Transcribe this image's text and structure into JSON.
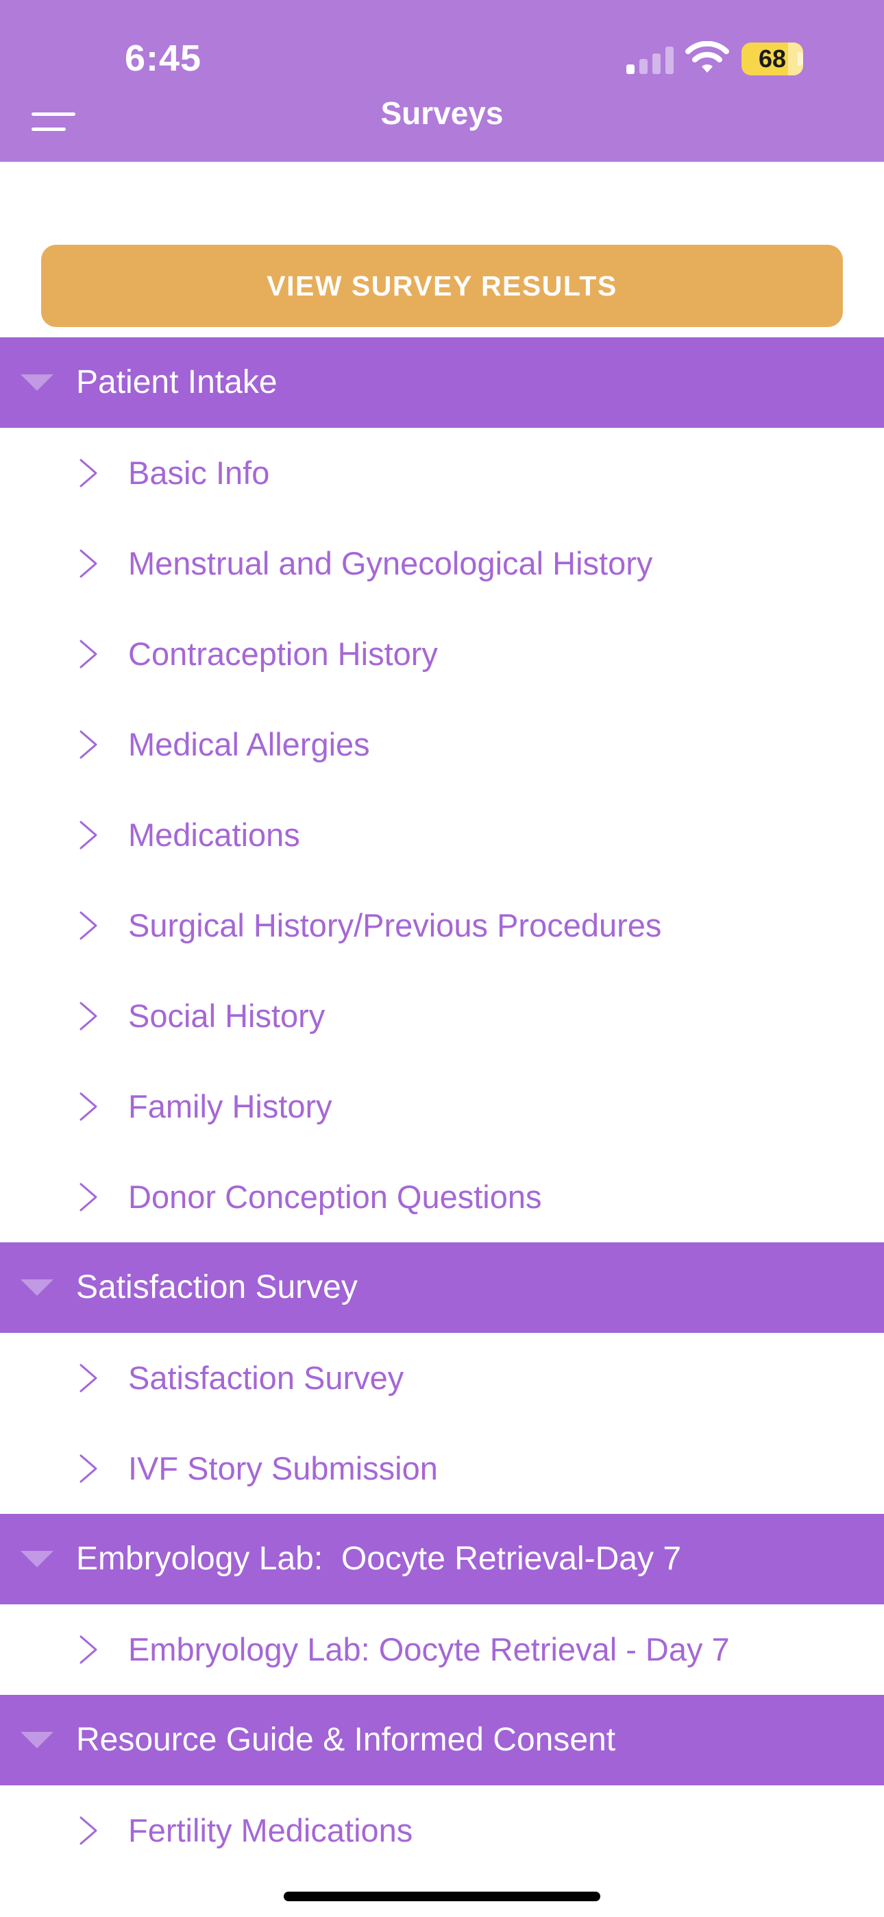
{
  "status_bar": {
    "time": "6:45",
    "battery": "68"
  },
  "header": {
    "title": "Surveys",
    "menu_icon": "hamburger-menu-icon"
  },
  "results_button": {
    "label": "VIEW SURVEY RESULTS"
  },
  "colors": {
    "header_bg": "#b07bd9",
    "section_bg": "#a163d6",
    "item_text": "#a567d6",
    "button_bg": "#e6ae5b"
  },
  "sections": [
    {
      "title": "Patient Intake",
      "items": [
        "Basic Info",
        "Menstrual and Gynecological History",
        "Contraception History",
        "Medical Allergies",
        "Medications",
        "Surgical History/Previous Procedures",
        "Social History",
        "Family History",
        "Donor Conception Questions"
      ]
    },
    {
      "title": "Satisfaction Survey",
      "items": [
        "Satisfaction Survey",
        "IVF Story Submission"
      ]
    },
    {
      "title": "Embryology Lab:  Oocyte Retrieval-Day 7",
      "items": [
        "Embryology Lab: Oocyte Retrieval - Day 7"
      ]
    },
    {
      "title": "Resource Guide & Informed Consent",
      "items": [
        "Fertility Medications"
      ]
    }
  ]
}
